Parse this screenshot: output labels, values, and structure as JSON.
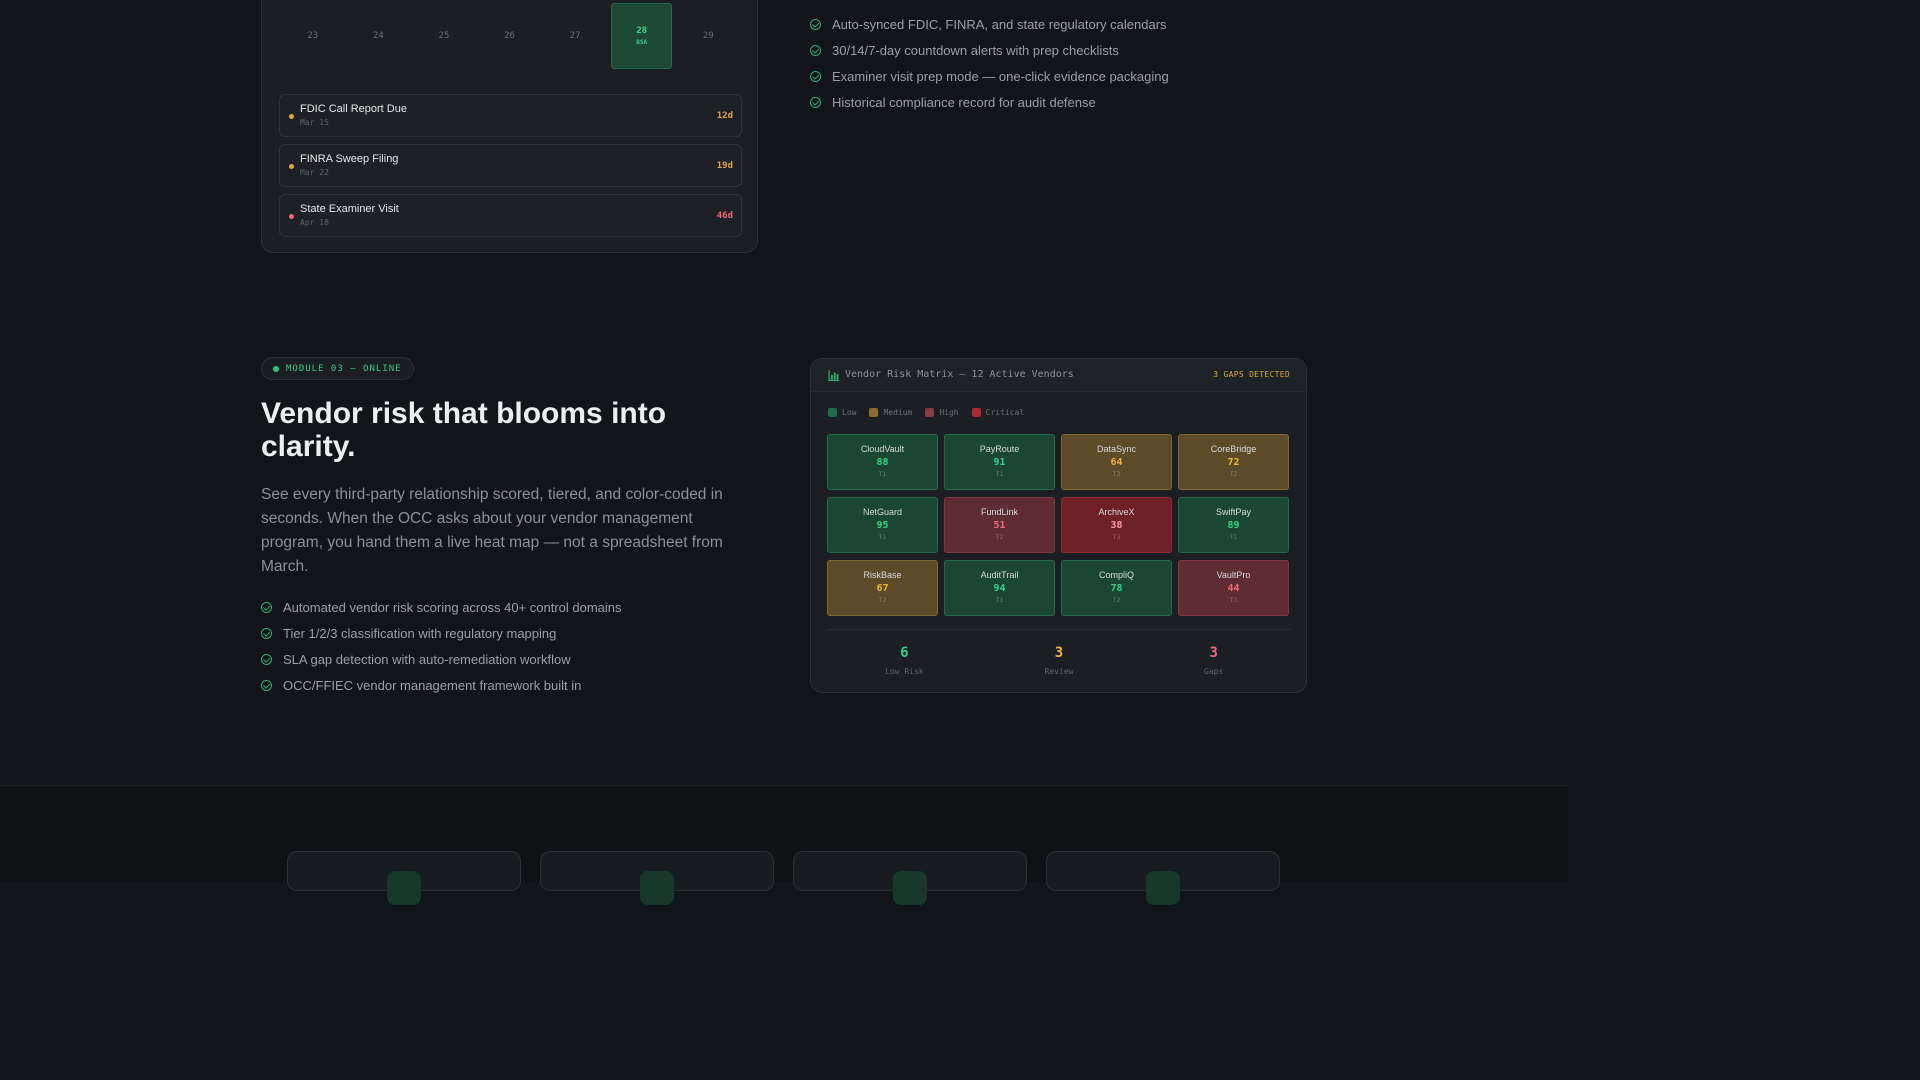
{
  "calendar": {
    "days": [
      {
        "label": "23",
        "tag": ""
      },
      {
        "label": "24",
        "tag": ""
      },
      {
        "label": "25",
        "tag": ""
      },
      {
        "label": "26",
        "tag": ""
      },
      {
        "label": "27",
        "tag": ""
      },
      {
        "label": "28",
        "tag": "BSA",
        "active": true
      },
      {
        "label": "29",
        "tag": ""
      }
    ],
    "deadlines": [
      {
        "title": "FDIC Call Report Due",
        "date": "Mar 15",
        "days": "12d",
        "color": "#e0a63c"
      },
      {
        "title": "FINRA Sweep Filing",
        "date": "Mar 22",
        "days": "19d",
        "color": "#e0a63c"
      },
      {
        "title": "State Examiner Visit",
        "date": "Apr 18",
        "days": "46d",
        "color": "#f0687a"
      }
    ]
  },
  "calendar_features": [
    "Auto-synced FDIC, FINRA, and state regulatory calendars",
    "30/14/7-day countdown alerts with prep checklists",
    "Examiner visit prep mode — one-click evidence packaging",
    "Historical compliance record for audit defense"
  ],
  "module": {
    "badge": "MODULE 03 — ONLINE",
    "heading": "Vendor risk that blooms into clarity.",
    "description": "See every third-party relationship scored, tiered, and color-coded in seconds. When the OCC asks about your vendor management program, you hand them a live heat map — not a spreadsheet from March.",
    "features": [
      "Automated vendor risk scoring across 40+ control domains",
      "Tier 1/2/3 classification with regulatory mapping",
      "SLA gap detection with auto-remediation workflow",
      "OCC/FFIEC vendor management framework built in"
    ]
  },
  "matrix": {
    "title": "Vendor Risk Matrix — 12 Active Vendors",
    "gaps_label": "3 GAPS DETECTED",
    "legend": [
      {
        "label": "Low",
        "color": "#1f6b4b"
      },
      {
        "label": "Medium",
        "color": "#8a6a30"
      },
      {
        "label": "High",
        "color": "#8a3a44"
      },
      {
        "label": "Critical",
        "color": "#a82a30"
      }
    ],
    "vendors": [
      {
        "name": "CloudVault",
        "score": "88",
        "tier": "T1",
        "level": "low"
      },
      {
        "name": "PayRoute",
        "score": "91",
        "tier": "T1",
        "level": "low"
      },
      {
        "name": "DataSync",
        "score": "64",
        "tier": "T2",
        "level": "medium"
      },
      {
        "name": "CoreBridge",
        "score": "72",
        "tier": "T2",
        "level": "medium"
      },
      {
        "name": "NetGuard",
        "score": "95",
        "tier": "T1",
        "level": "low"
      },
      {
        "name": "FundLink",
        "score": "51",
        "tier": "T2",
        "level": "high"
      },
      {
        "name": "ArchiveX",
        "score": "38",
        "tier": "T3",
        "level": "critical"
      },
      {
        "name": "SwiftPay",
        "score": "89",
        "tier": "T1",
        "level": "low"
      },
      {
        "name": "RiskBase",
        "score": "67",
        "tier": "T2",
        "level": "medium"
      },
      {
        "name": "AuditTrail",
        "score": "94",
        "tier": "T1",
        "level": "low"
      },
      {
        "name": "CompliQ",
        "score": "78",
        "tier": "T2",
        "level": "low"
      },
      {
        "name": "VaultPro",
        "score": "44",
        "tier": "T3",
        "level": "high"
      }
    ],
    "summary": [
      {
        "value": "6",
        "label": "Low Risk",
        "color": "#32d286"
      },
      {
        "value": "3",
        "label": "Review",
        "color": "#f2b437"
      },
      {
        "value": "3",
        "label": "Gaps",
        "color": "#f0687a"
      }
    ]
  }
}
